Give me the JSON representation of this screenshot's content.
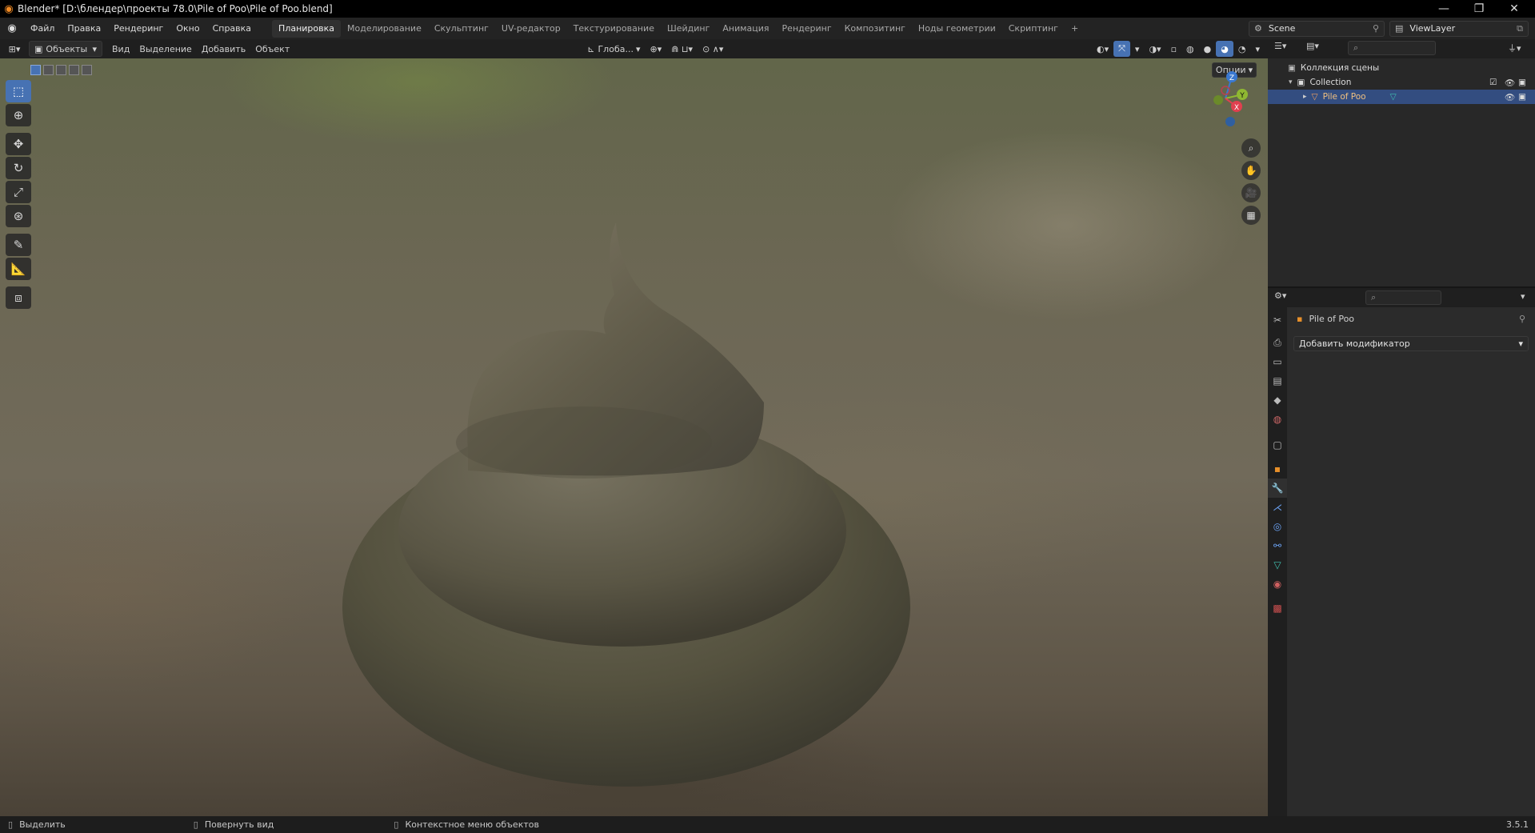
{
  "window": {
    "title": "Blender* [D:\\блендер\\проекты 78.0\\Pile of Poo\\Pile of Poo.blend]",
    "minimize": "—",
    "maximize": "❐",
    "close": "✕"
  },
  "menu": [
    "Файл",
    "Правка",
    "Рендеринг",
    "Окно",
    "Справка"
  ],
  "workspaces": {
    "active": "Планировка",
    "others": [
      "Моделирование",
      "Скульптинг",
      "UV-редактор",
      "Текстурирование",
      "Шейдинг",
      "Анимация",
      "Рендеринг",
      "Композитинг",
      "Ноды геометрии",
      "Скриптинг"
    ],
    "add": "+"
  },
  "scene": {
    "name": "Scene",
    "view_layer": "ViewLayer"
  },
  "viewport_header": {
    "mode": "Объекты",
    "menus": [
      "Вид",
      "Выделение",
      "Добавить",
      "Объект"
    ],
    "orientation": "Глоба...",
    "options": "Опции"
  },
  "navigation_gizmo": {
    "z": "Z",
    "y": "Y",
    "x": "X"
  },
  "outliner": {
    "root": "Коллекция сцены",
    "collection": "Collection",
    "object": "Pile of Poo"
  },
  "properties": {
    "object_name": "Pile of Poo",
    "add_modifier": "Добавить модификатор"
  },
  "statusbar": {
    "select": "Выделить",
    "rotate": "Повернуть вид",
    "context_menu": "Контекстное меню объектов",
    "version": "3.5.1"
  },
  "colors": {
    "accent": "#4772b3",
    "selected_row": "#334d80",
    "object_body": "#5d5a4a"
  },
  "icons": {
    "tools": [
      "select-box-icon",
      "cursor-icon",
      "move-icon",
      "rotate-icon",
      "scale-icon",
      "transform-icon",
      "annotate-icon",
      "measure-icon",
      "add-cube-icon"
    ],
    "view": [
      "zoom-icon",
      "hand-pan-icon",
      "camera-icon",
      "grid-ortho-icon"
    ]
  }
}
